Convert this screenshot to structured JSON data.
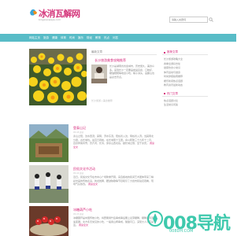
{
  "header": {
    "logo_title": "冰消瓦解网",
    "logo_subtitle": "bingxiaowajie.com",
    "search_placeholder": "请输入关键词"
  },
  "nav": {
    "items": [
      "网站主页",
      "旅游",
      "健康",
      "体育",
      "时尚",
      "娱乐",
      "财经",
      "教育",
      "热点",
      "问答"
    ]
  },
  "feature": {
    "heading": "最新文章",
    "title": "长沙旅游美食攻略推荐",
    "text": "长沙是湖南省省会城市，历史悠久，美食众多。来到长沙一定要品尝臭豆腐、口味虾、糖油粑粑等地道小吃，橘子洲头、岳麓山也是必去景点。",
    "more": "长沙旅游 | 美食推荐"
  },
  "sidebar": {
    "heading": "推荐文章",
    "items": [
      "长沙旅游攻略大全",
      "春季出游好去处",
      "健康饮食小常识",
      "体育运动与健身",
      "时尚穿搭指南推荐",
      "娱乐新闻热点话题",
      "教育资讯最新动态"
    ],
    "heading2": "热门文章",
    "items2": [
      "热点话题讨论",
      "生活常识问答"
    ]
  },
  "articles": [
    {
      "title": "登泰山记",
      "date": "05-18 阅读",
      "text": "泰山之阳，汶水西流；其阴，济水东流。阳谷皆入汶，阴谷皆入济。当其南北分者，古长城也。最高日观峰，在长城南十五里。余以乾隆三十九年十二月，自京师乘风雪，历齐河、长清，穿泰山西北谷，越长城之限，至于泰安。",
      "more": "阅读全文"
    },
    {
      "title": "民俗文化节活动",
      "date": "05-16 阅读",
      "text": "近日，民俗文化节在市中心广场隆重开幕，来自各地的民间艺术团体带来了精彩纷呈的传统表演，舞龙舞狮、腰鼓秧歌等节目吸引了大批市民驻足观看，现场气氛热烈。",
      "more": "阅读全文"
    },
    {
      "title": "冰糖葫芦小吃",
      "date": "05-15 阅读",
      "text": "冰糖葫芦是中国传统小吃，将野果用竹签串成串后蘸上麦芽糖稀，糖稀遇风迅速变硬。北方冬天常见的小吃，一般用山楂串成，酸甜可口，深受大人小孩喜爱。",
      "more": "阅读全文"
    }
  ],
  "watermark": {
    "text": "008导航",
    "url": "008DH.COM"
  },
  "colors": {
    "nav": "#58bcc7",
    "accent": "#d6297c",
    "watermark": "#3ec9ad"
  }
}
